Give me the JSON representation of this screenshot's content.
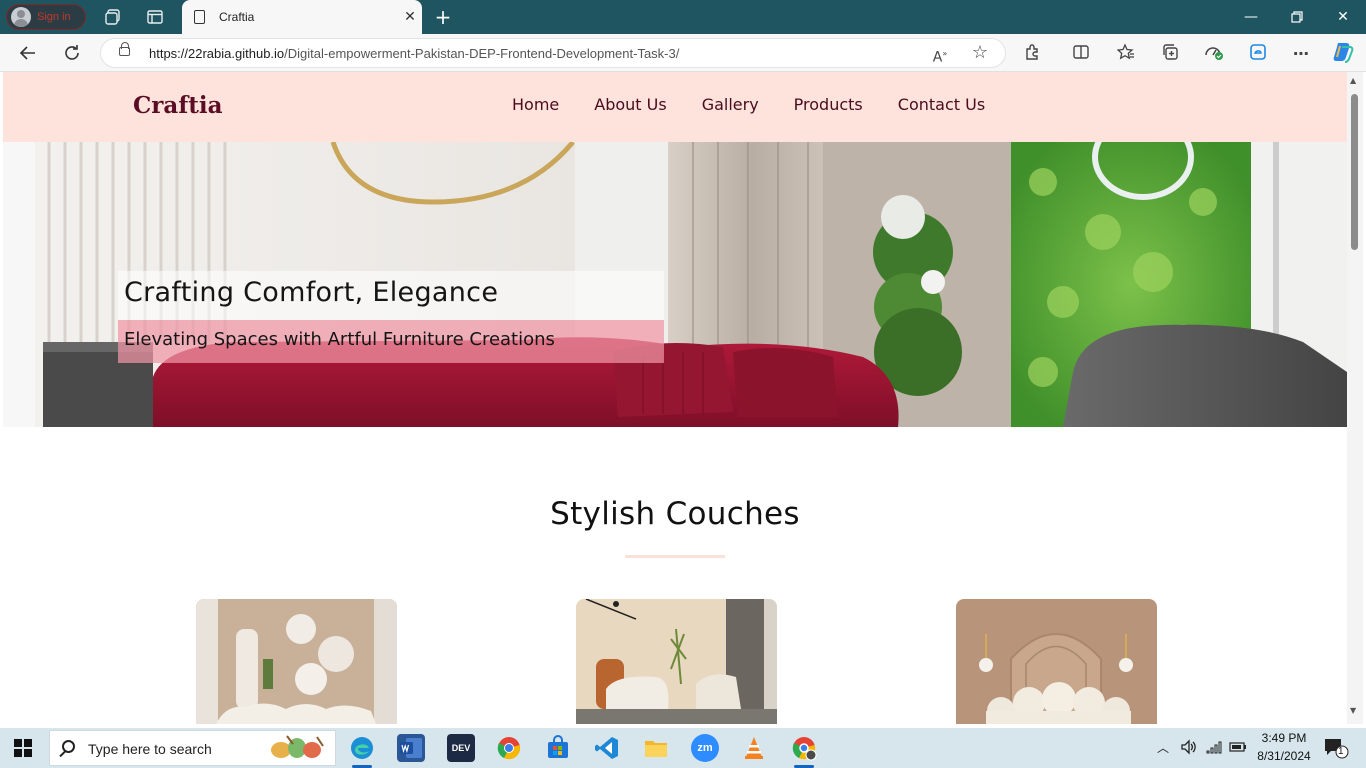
{
  "browser": {
    "profile_label": "Sign in",
    "tab_title": "Craftia",
    "url_host": "https://22rabia.github.io",
    "url_path": "/Digital-empowerment-Pakistan-DEP-Frontend-Development-Task-3/"
  },
  "site": {
    "logo": "Craftia",
    "nav": [
      "Home",
      "About Us",
      "Gallery",
      "Products",
      "Contact Us"
    ],
    "hero": {
      "title": "Crafting Comfort, Elegance",
      "subtitle": "Elevating Spaces with Artful Furniture Creations"
    },
    "section": {
      "title": "Stylish Couches"
    },
    "colors": {
      "header_bg": "#fde3dc",
      "logo": "#5b0d25",
      "nav_text": "#4a0b1e",
      "accent_divider": "#fbe1d9"
    }
  },
  "taskbar": {
    "search_placeholder": "Type here to search",
    "time": "3:49 PM",
    "date": "8/31/2024",
    "notification_count": "1",
    "apps": [
      "edge-icon",
      "word-icon",
      "dev-icon",
      "chrome-icon",
      "store-icon",
      "vscode-icon",
      "file-explorer-icon",
      "zoom-icon",
      "vlc-icon",
      "chrome-profile-icon"
    ],
    "dev_label": "DEV",
    "zoom_label": "zm"
  }
}
